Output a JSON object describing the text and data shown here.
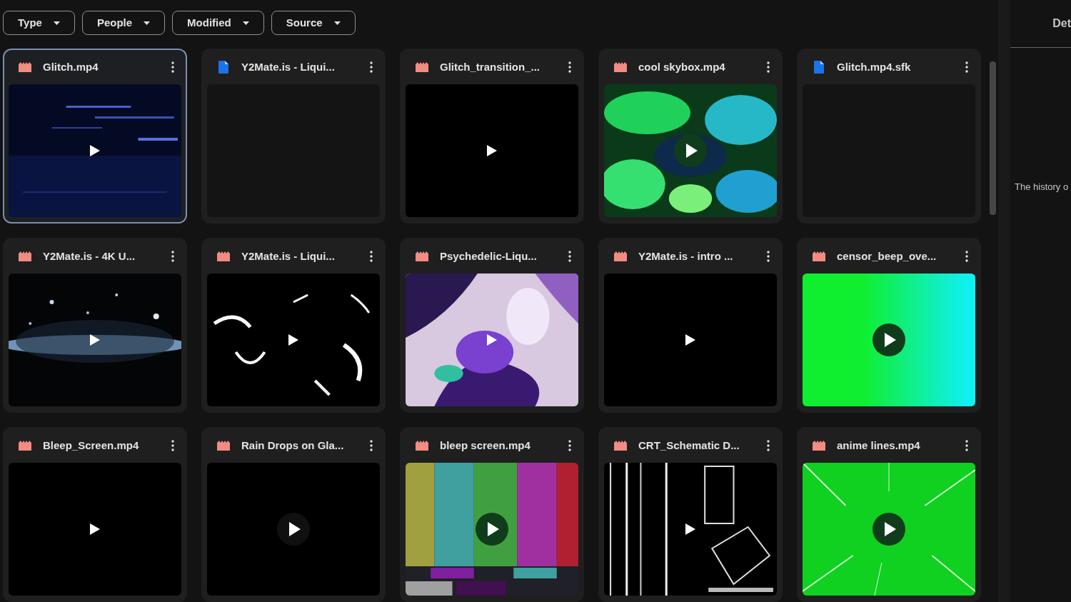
{
  "filters": [
    {
      "label": "Type"
    },
    {
      "label": "People"
    },
    {
      "label": "Modified"
    },
    {
      "label": "Source"
    }
  ],
  "files": [
    {
      "name": "Glitch.mp4",
      "kind": "video",
      "selected": true
    },
    {
      "name": "Y2Mate.is - Liqui...",
      "kind": "document",
      "selected": false,
      "preview": {
        "kind": "empty"
      }
    },
    {
      "name": "Glitch_transition_...",
      "kind": "video",
      "selected": false,
      "preview": {
        "kind": "black"
      }
    },
    {
      "name": "cool skybox.mp4",
      "kind": "video",
      "selected": false
    },
    {
      "name": "Glitch.mp4.sfk",
      "kind": "document",
      "selected": false,
      "preview": {
        "kind": "empty"
      }
    },
    {
      "name": "Y2Mate.is - 4K U...",
      "kind": "video",
      "selected": false
    },
    {
      "name": "Y2Mate.is - Liqui...",
      "kind": "video",
      "selected": false
    },
    {
      "name": "Psychedelic-Liqu...",
      "kind": "video",
      "selected": false
    },
    {
      "name": "Y2Mate.is - intro ...",
      "kind": "video",
      "selected": false,
      "preview": {
        "kind": "black"
      }
    },
    {
      "name": "censor_beep_ove...",
      "kind": "video",
      "selected": false
    },
    {
      "name": "Bleep_Screen.mp4",
      "kind": "video",
      "selected": false,
      "preview": {
        "kind": "black"
      }
    },
    {
      "name": "Rain Drops on Gla...",
      "kind": "video",
      "selected": false,
      "preview": {
        "kind": "black"
      }
    },
    {
      "name": "bleep screen.mp4",
      "kind": "video",
      "selected": false
    },
    {
      "name": "CRT_Schematic D...",
      "kind": "video",
      "selected": false
    },
    {
      "name": "anime lines.mp4",
      "kind": "video",
      "selected": false
    }
  ],
  "details_panel": {
    "title": "Det",
    "text": "The history o"
  }
}
